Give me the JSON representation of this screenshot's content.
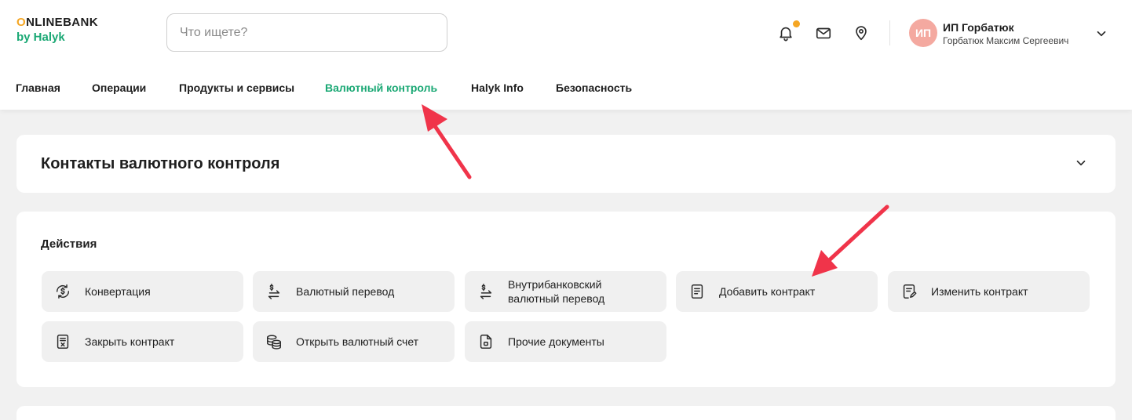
{
  "logo": {
    "line1_first": "O",
    "line1_rest": "NLINEBANK",
    "line2": "by Halyk"
  },
  "search": {
    "placeholder": "Что ищете?"
  },
  "header_icons": [
    "bell-icon",
    "mail-icon",
    "location-pin-icon"
  ],
  "user": {
    "initials": "ИП",
    "name": "ИП Горбатюк",
    "full_name": "Горбатюк Максим Сергеевич"
  },
  "nav": {
    "items": [
      {
        "label": "Главная"
      },
      {
        "label": "Операции"
      },
      {
        "label": "Продукты и сервисы"
      },
      {
        "label": "Валютный контроль",
        "active": true
      },
      {
        "label": "Halyk Info"
      },
      {
        "label": "Безопасность"
      }
    ]
  },
  "contacts_card": {
    "title": "Контакты валютного контроля"
  },
  "actions_card": {
    "title": "Действия",
    "actions": [
      {
        "label": "Конвертация",
        "icon": "currency-exchange-icon"
      },
      {
        "label": "Валютный перевод",
        "icon": "dollar-transfer-icon"
      },
      {
        "label_line1": "Внутрибанковский",
        "label_line2": "валютный перевод",
        "icon": "dollar-transfer-icon"
      },
      {
        "label": "Добавить контракт",
        "icon": "document-icon"
      },
      {
        "label": "Изменить контракт",
        "icon": "edit-document-icon"
      },
      {
        "label": "Закрыть контракт",
        "icon": "close-document-icon"
      },
      {
        "label": "Открыть валютный счет",
        "icon": "coins-stack-icon"
      },
      {
        "label": "Прочие документы",
        "icon": "file-icon"
      }
    ]
  },
  "colors": {
    "accent": "#1aa874",
    "notification": "#f5a623",
    "avatar": "#f4a9a0",
    "annotation_arrow": "#f0344a"
  }
}
